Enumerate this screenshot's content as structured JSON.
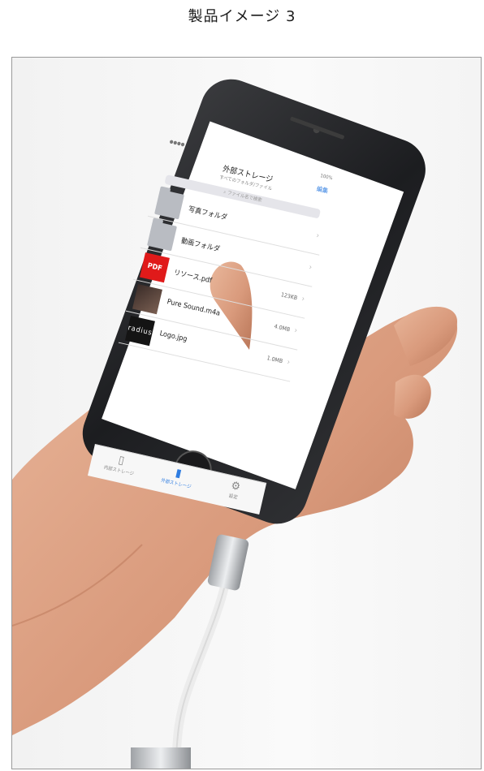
{
  "caption": "製品イメージ 3",
  "screen": {
    "status_left": "●●●● ",
    "status_right": "100%",
    "nav_title": "外部ストレージ",
    "nav_subtitle": "すべてのフォルダ/ファイル",
    "nav_edit": "編集",
    "search_placeholder": "ファイル名で検索",
    "rows": [
      {
        "name": "写真フォルダ",
        "size": "",
        "kind": "folder",
        "thumb_text": ""
      },
      {
        "name": "動画フォルダ",
        "size": "",
        "kind": "folder",
        "thumb_text": ""
      },
      {
        "name": "リソース.pdf",
        "size": "123KB",
        "kind": "pdf",
        "thumb_text": "PDF"
      },
      {
        "name": "Pure Sound.m4a",
        "size": "4.0MB",
        "kind": "music",
        "thumb_text": ""
      },
      {
        "name": "Logo.jpg",
        "size": "1.0MB",
        "kind": "logo",
        "thumb_text": "radius"
      }
    ],
    "tabs": [
      {
        "label": "内部ストレージ",
        "icon": "phone-icon",
        "active": false
      },
      {
        "label": "外部ストレージ",
        "icon": "storage-icon",
        "active": true
      },
      {
        "label": "設定",
        "icon": "gear-icon",
        "active": false
      }
    ],
    "accent_color": "#2f7de1"
  }
}
